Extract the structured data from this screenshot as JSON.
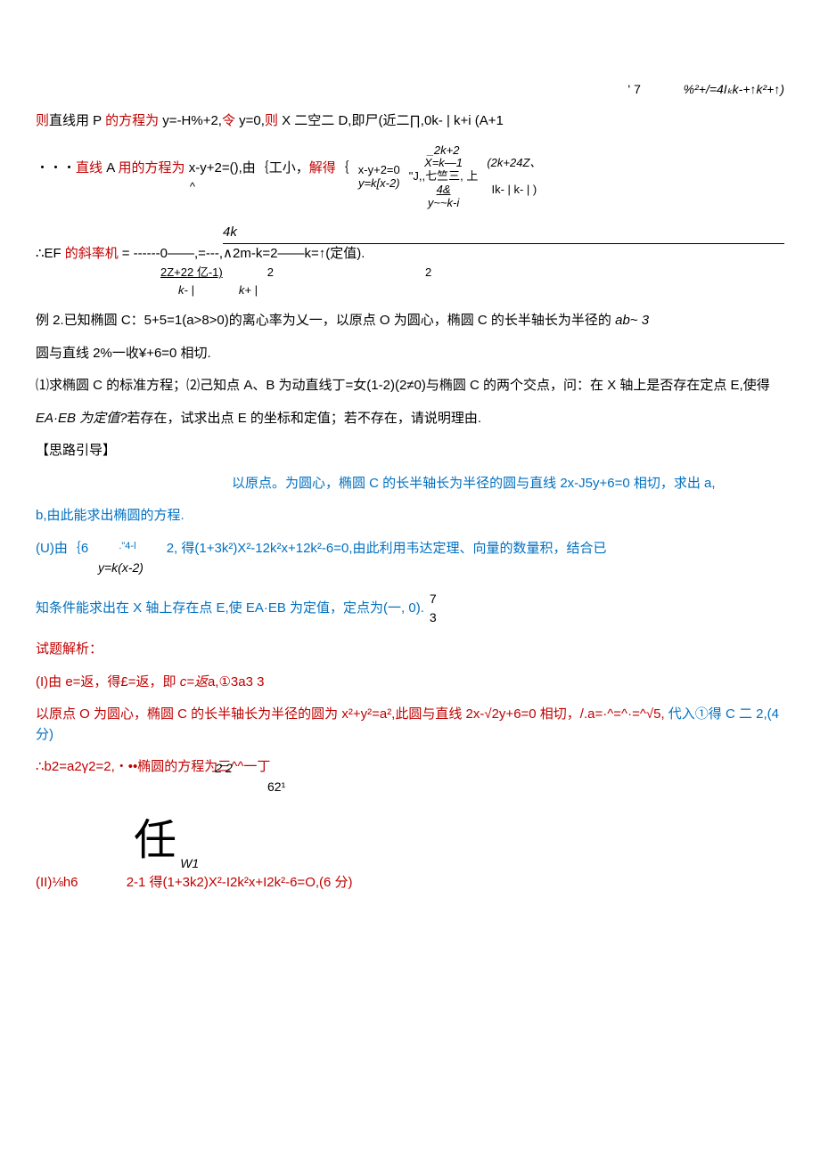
{
  "topright": {
    "left_seg": "'        7",
    "right_seg": "%²+/=4Iₖk-+↑k²+↑)"
  },
  "p1": {
    "t1": "则",
    "t2": "直线用 P ",
    "t3": "的方程为",
    "t4": " y=-H%+2,",
    "t5": "令",
    "t6": " y=0,",
    "t7": "则",
    "t8": " X 二空二 D,即尸(近二∏,0k- |        k+i    (A+1"
  },
  "p2": {
    "t1": "・・・",
    "t2": "直线",
    "t3": " A ",
    "t4": "用的方程为",
    "t5": " x-y+2=(),由｛工小，",
    "t6": "解得",
    "t7": "｛",
    "mid_top": "x-y+2=0",
    "mid_bot": "y=k[x-2)",
    "col2_1": "_2k+2",
    "col2_2": "X=k—1",
    "col2_3": "\"J,,七竺三, 上",
    "col2_4": "4&",
    "col2_5": "y~~k-i",
    "right1": "(2k+24Z、",
    "right2": "Ik- | k- | )",
    "caret": "^"
  },
  "p3": {
    "label1": "∴EF ",
    "label2": "的斜率机",
    "eq1": "= ------0——,=---,∧2m-k=2——k=↑(定值).",
    "top4k": "4k",
    "frac_top": "2Z+22 亿-1)",
    "frac_mid": "2",
    "frac_mid2": "2",
    "bot1": "k- |",
    "bot2": "k+ |"
  },
  "p4": {
    "t1": "例 2.已知椭圆 C：5+5=1(a>8>0)的离心率为乂一，以原点 O 为圆心，椭圆 C 的长半轴长为半径的 ",
    "t2": "ab~     3"
  },
  "p5": {
    "t": "圆与直线 2%一收¥+6=0 相切."
  },
  "p6": {
    "t": "⑴求椭圆 C 的标准方程；⑵己知点 A、B 为动直线丁=女(1-2)(2≠0)与椭圆 C 的两个交点，问：在 X 轴上是否存在定点 E,使得"
  },
  "p7": {
    "t1": "EA·EB 为定值?",
    "t2": "若存在，试求出点 E 的坐标和定值；若不存在，请说明理由."
  },
  "p8": {
    "t": "【思路引导】"
  },
  "p9": {
    "t": "以原点。为圆心，椭圆 C 的长半轴长为半径的圆与直线 2x-J5y+6=0 相切，求出 a,"
  },
  "p10": {
    "t": "b,由此能求出椭圆的方程."
  },
  "p11": {
    "pre": "(U)由｛6",
    "sup": ".\"4-l",
    "mid": "2, 得(1+3k²)X²-12k²x+12k²-6=0,由此利用韦达定理、向量的数量积，结合已",
    "under": "y=k(x-2)"
  },
  "p12": {
    "t": "知条件能求出在 X 轴上存在点 E,使 EA·EB 为定值，定点为(一, 0).",
    "f7": "7",
    "f3": "3"
  },
  "p13": {
    "t": "试题解析："
  },
  "p14": {
    "t1": "(I)由 e=返，得£=返，即 ",
    "t2": "c=返",
    "t3": "a,①3a3 3"
  },
  "p15": {
    "t1": "以原点 O 为圆心，椭圆 C 的长半轴长为半径的圆为 x²+y²=a²,此圆与直线 2x-√2y+6=0 相切，/.a=·^=^·=^√5,",
    "t2": "代入①得 C 二 2,(4 分)"
  },
  "p16": {
    "t1": "∴b2=a2γ2=2,・••椭圆的方程为三^^一丁",
    "top": "2     2",
    "bot": "62¹"
  },
  "p17": {
    "big": "任",
    "w1": "W1",
    "t1": "(II)⅛h6",
    "t2": "2-1 得(1+3k2)X²-I2k²x+I2k²-6=O,(6 分)"
  }
}
